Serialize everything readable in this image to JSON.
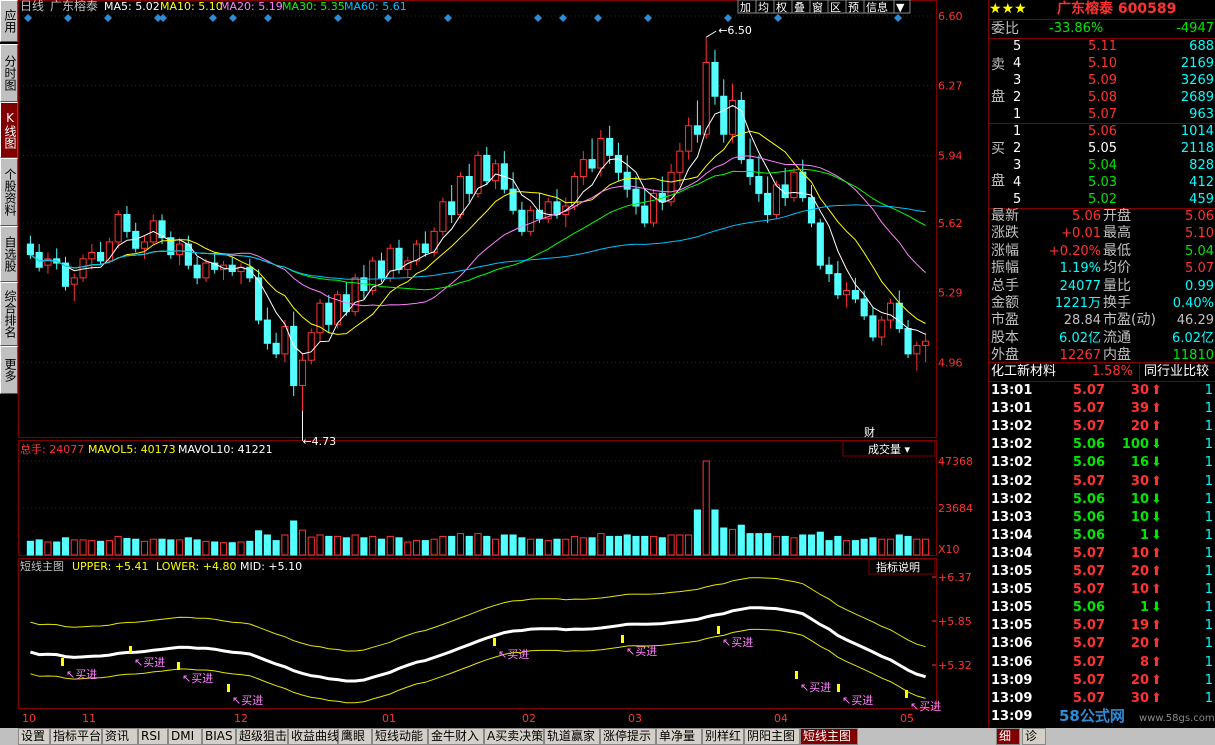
{
  "left_tabs": [
    "应用",
    "分时图",
    "K线图",
    "个股资料",
    "自选股",
    "综合排名",
    "更多"
  ],
  "header": {
    "period": "日线",
    "stock_name": "广东榕泰",
    "ma": [
      {
        "label": "MA5: 5.02",
        "color": "#ffffff"
      },
      {
        "label": "MA10: 5.10",
        "color": "#ffff00"
      },
      {
        "label": "MA20: 5.19",
        "color": "#ff80ff"
      },
      {
        "label": "MA30: 5.35",
        "color": "#00ff00"
      },
      {
        "label": "MA60: 5.61",
        "color": "#00c0ff"
      }
    ],
    "toolbar": [
      "加",
      "均",
      "权",
      "叠",
      "窗",
      "区",
      "预",
      "信息",
      "▼"
    ]
  },
  "price_axis": [
    "6.60",
    "6.27",
    "5.94",
    "5.62",
    "5.29",
    "4.96"
  ],
  "annotations": {
    "high": "6.50",
    "low": "4.73",
    "cai": "财"
  },
  "volume": {
    "label_total": "总手: 24077",
    "label_mavol5": "MAVOL5: 40173",
    "label_mavol10": "MAVOL10: 41221",
    "dropdown": "成交量",
    "axis": [
      "47368",
      "23684"
    ],
    "unit": "X10"
  },
  "indicator": {
    "label_name": "短线主图",
    "label_upper": "UPPER: +5.41",
    "label_lower": "LOWER: +4.80",
    "label_mid": "MID: +5.10",
    "button": "指标说明",
    "axis": [
      "+6.37",
      "+5.85",
      "+5.32"
    ],
    "signal": "买进"
  },
  "date_axis": [
    "10",
    "11",
    "12",
    "01",
    "02",
    "03",
    "04",
    "05"
  ],
  "right": {
    "stars": "★★★",
    "name_code": "广东榕泰 600589",
    "weibi_label": "委比",
    "weibi": "-33.86%",
    "weicha": "-4947",
    "sell_label": [
      "卖",
      "盘"
    ],
    "buy_label": [
      "买",
      "盘"
    ],
    "sells": [
      {
        "lvl": "5",
        "price": "5.11",
        "vol": "688"
      },
      {
        "lvl": "4",
        "price": "5.10",
        "vol": "2169"
      },
      {
        "lvl": "3",
        "price": "5.09",
        "vol": "3269"
      },
      {
        "lvl": "2",
        "price": "5.08",
        "vol": "2689"
      },
      {
        "lvl": "1",
        "price": "5.07",
        "vol": "963"
      }
    ],
    "buys": [
      {
        "lvl": "1",
        "price": "5.06",
        "vol": "1014",
        "pc": "#ff3232"
      },
      {
        "lvl": "2",
        "price": "5.05",
        "vol": "2118",
        "pc": "#ffffff"
      },
      {
        "lvl": "3",
        "price": "5.04",
        "vol": "828",
        "pc": "#00e600"
      },
      {
        "lvl": "4",
        "price": "5.03",
        "vol": "412",
        "pc": "#00e600"
      },
      {
        "lvl": "5",
        "price": "5.02",
        "vol": "459",
        "pc": "#00e600"
      }
    ],
    "stats": [
      {
        "l1": "最新",
        "v1": "5.06",
        "c1": "#ff3232",
        "l2": "开盘",
        "v2": "5.06",
        "c2": "#ff3232"
      },
      {
        "l1": "涨跌",
        "v1": "+0.01",
        "c1": "#ff3232",
        "l2": "最高",
        "v2": "5.10",
        "c2": "#ff3232"
      },
      {
        "l1": "涨幅",
        "v1": "+0.20%",
        "c1": "#ff3232",
        "l2": "最低",
        "v2": "5.04",
        "c2": "#00e600"
      },
      {
        "l1": "振幅",
        "v1": "1.19%",
        "c1": "#00ffff",
        "l2": "均价",
        "v2": "5.07",
        "c2": "#ff3232"
      },
      {
        "l1": "总手",
        "v1": "24077",
        "c1": "#00ffff",
        "l2": "量比",
        "v2": "0.99",
        "c2": "#00ffff"
      },
      {
        "l1": "金额",
        "v1": "1221万",
        "c1": "#00ffff",
        "l2": "换手",
        "v2": "0.40%",
        "c2": "#00ffff"
      },
      {
        "l1": "市盈",
        "v1": "28.84",
        "c1": "#c0c0c0",
        "l2": "市盈(动)",
        "v2": "46.29",
        "c2": "#c0c0c0"
      },
      {
        "l1": "股本",
        "v1": "6.02亿",
        "c1": "#00ffff",
        "l2": "流通",
        "v2": "6.02亿",
        "c2": "#00ffff"
      },
      {
        "l1": "外盘",
        "v1": "12267",
        "c1": "#ff3232",
        "l2": "内盘",
        "v2": "11810",
        "c2": "#00e600"
      }
    ],
    "sector": "化工新材料",
    "sector_pct": "1.58%",
    "sector_btn": "同行业比较",
    "ticks": [
      {
        "t": "13:01",
        "p": "5.07",
        "v": "30",
        "d": "up",
        "n": "1"
      },
      {
        "t": "13:01",
        "p": "5.07",
        "v": "39",
        "d": "up",
        "n": "1"
      },
      {
        "t": "13:02",
        "p": "5.07",
        "v": "20",
        "d": "up",
        "n": "1"
      },
      {
        "t": "13:02",
        "p": "5.06",
        "v": "100",
        "d": "down",
        "n": "1"
      },
      {
        "t": "13:02",
        "p": "5.06",
        "v": "16",
        "d": "down",
        "n": "1"
      },
      {
        "t": "13:02",
        "p": "5.07",
        "v": "30",
        "d": "up",
        "n": "1"
      },
      {
        "t": "13:02",
        "p": "5.06",
        "v": "10",
        "d": "down",
        "n": "1"
      },
      {
        "t": "13:03",
        "p": "5.06",
        "v": "10",
        "d": "down",
        "n": "1"
      },
      {
        "t": "13:04",
        "p": "5.06",
        "v": "1",
        "d": "down",
        "n": "1"
      },
      {
        "t": "13:04",
        "p": "5.07",
        "v": "10",
        "d": "up",
        "n": "1"
      },
      {
        "t": "13:05",
        "p": "5.07",
        "v": "20",
        "d": "up",
        "n": "1"
      },
      {
        "t": "13:05",
        "p": "5.07",
        "v": "10",
        "d": "up",
        "n": "1"
      },
      {
        "t": "13:05",
        "p": "5.06",
        "v": "1",
        "d": "down",
        "n": "1"
      },
      {
        "t": "13:05",
        "p": "5.07",
        "v": "19",
        "d": "up",
        "n": "1"
      },
      {
        "t": "13:06",
        "p": "5.07",
        "v": "20",
        "d": "up",
        "n": "1"
      },
      {
        "t": "13:06",
        "p": "5.07",
        "v": "8",
        "d": "up",
        "n": "1"
      },
      {
        "t": "13:09",
        "p": "5.07",
        "v": "20",
        "d": "up",
        "n": "1"
      },
      {
        "t": "13:09",
        "p": "5.07",
        "v": "30",
        "d": "up",
        "n": "1"
      },
      {
        "t": "13:09",
        "p": "",
        "v": "",
        "d": "",
        "n": ""
      }
    ],
    "tabs": [
      "细",
      "诊"
    ]
  },
  "bottom_tabs": [
    "设置",
    "指标平台",
    "资讯",
    "RSI",
    "DMI",
    "BIAS",
    "超级狙击",
    "收益曲线",
    "鹰眼",
    "短线动能",
    "金牛财入",
    "A买卖决策",
    "轨道赢家",
    "涨停提示",
    "单净量",
    "别样红",
    "阴阳主图",
    "短线主图"
  ],
  "watermark": "58公式网",
  "watermark_url": "www.58gs.com",
  "colors": {
    "up": "#ff3232",
    "down": "#54ffff",
    "frame": "#800000"
  },
  "chart_data": {
    "type": "candlestick",
    "ylim": [
      4.63,
      6.6
    ],
    "candles": [
      [
        5.52,
        5.56,
        5.45,
        5.47
      ],
      [
        5.48,
        5.52,
        5.39,
        5.41
      ],
      [
        5.42,
        5.48,
        5.38,
        5.45
      ],
      [
        5.45,
        5.5,
        5.4,
        5.43
      ],
      [
        5.43,
        5.46,
        5.3,
        5.32
      ],
      [
        5.33,
        5.38,
        5.25,
        5.36
      ],
      [
        5.36,
        5.47,
        5.34,
        5.45
      ],
      [
        5.45,
        5.52,
        5.4,
        5.48
      ],
      [
        5.48,
        5.53,
        5.42,
        5.44
      ],
      [
        5.44,
        5.55,
        5.43,
        5.53
      ],
      [
        5.53,
        5.68,
        5.5,
        5.66
      ],
      [
        5.66,
        5.7,
        5.55,
        5.58
      ],
      [
        5.58,
        5.62,
        5.48,
        5.5
      ],
      [
        5.5,
        5.56,
        5.45,
        5.53
      ],
      [
        5.53,
        5.66,
        5.52,
        5.63
      ],
      [
        5.63,
        5.66,
        5.52,
        5.55
      ],
      [
        5.55,
        5.58,
        5.45,
        5.47
      ],
      [
        5.47,
        5.55,
        5.42,
        5.52
      ],
      [
        5.52,
        5.56,
        5.4,
        5.42
      ],
      [
        5.42,
        5.46,
        5.33,
        5.36
      ],
      [
        5.36,
        5.45,
        5.34,
        5.43
      ],
      [
        5.43,
        5.48,
        5.38,
        5.4
      ],
      [
        5.4,
        5.44,
        5.35,
        5.42
      ],
      [
        5.42,
        5.46,
        5.37,
        5.39
      ],
      [
        5.39,
        5.43,
        5.33,
        5.41
      ],
      [
        5.41,
        5.45,
        5.34,
        5.36
      ],
      [
        5.36,
        5.4,
        5.14,
        5.16
      ],
      [
        5.16,
        5.22,
        5.02,
        5.05
      ],
      [
        5.05,
        5.1,
        4.98,
        5.0
      ],
      [
        5.0,
        5.16,
        4.96,
        5.13
      ],
      [
        5.13,
        5.2,
        4.8,
        4.85
      ],
      [
        4.85,
        5.0,
        4.73,
        4.97
      ],
      [
        4.97,
        5.12,
        4.95,
        5.1
      ],
      [
        5.1,
        5.26,
        5.06,
        5.24
      ],
      [
        5.24,
        5.28,
        5.1,
        5.14
      ],
      [
        5.14,
        5.3,
        5.12,
        5.28
      ],
      [
        5.28,
        5.34,
        5.18,
        5.2
      ],
      [
        5.2,
        5.38,
        5.18,
        5.36
      ],
      [
        5.36,
        5.42,
        5.26,
        5.3
      ],
      [
        5.3,
        5.46,
        5.28,
        5.44
      ],
      [
        5.44,
        5.48,
        5.34,
        5.36
      ],
      [
        5.36,
        5.52,
        5.34,
        5.5
      ],
      [
        5.5,
        5.54,
        5.38,
        5.4
      ],
      [
        5.4,
        5.46,
        5.36,
        5.44
      ],
      [
        5.44,
        5.54,
        5.42,
        5.52
      ],
      [
        5.52,
        5.58,
        5.46,
        5.48
      ],
      [
        5.48,
        5.6,
        5.46,
        5.58
      ],
      [
        5.58,
        5.74,
        5.56,
        5.72
      ],
      [
        5.72,
        5.8,
        5.62,
        5.66
      ],
      [
        5.66,
        5.86,
        5.64,
        5.84
      ],
      [
        5.84,
        5.9,
        5.72,
        5.76
      ],
      [
        5.76,
        5.96,
        5.74,
        5.94
      ],
      [
        5.94,
        5.98,
        5.8,
        5.82
      ],
      [
        5.82,
        5.92,
        5.78,
        5.9
      ],
      [
        5.9,
        5.96,
        5.76,
        5.78
      ],
      [
        5.78,
        5.86,
        5.66,
        5.68
      ],
      [
        5.68,
        5.72,
        5.56,
        5.58
      ],
      [
        5.58,
        5.7,
        5.56,
        5.68
      ],
      [
        5.68,
        5.76,
        5.62,
        5.64
      ],
      [
        5.64,
        5.74,
        5.62,
        5.72
      ],
      [
        5.72,
        5.78,
        5.64,
        5.66
      ],
      [
        5.66,
        5.74,
        5.6,
        5.7
      ],
      [
        5.7,
        5.86,
        5.68,
        5.84
      ],
      [
        5.84,
        5.96,
        5.8,
        5.92
      ],
      [
        5.92,
        6.02,
        5.86,
        5.88
      ],
      [
        5.88,
        6.06,
        5.84,
        6.02
      ],
      [
        6.02,
        6.08,
        5.9,
        5.94
      ],
      [
        5.94,
        6.0,
        5.82,
        5.86
      ],
      [
        5.86,
        5.94,
        5.74,
        5.78
      ],
      [
        5.78,
        5.84,
        5.66,
        5.7
      ],
      [
        5.7,
        5.78,
        5.6,
        5.62
      ],
      [
        5.62,
        5.78,
        5.6,
        5.76
      ],
      [
        5.76,
        5.84,
        5.68,
        5.72
      ],
      [
        5.72,
        5.9,
        5.7,
        5.86
      ],
      [
        5.86,
        6.0,
        5.8,
        5.96
      ],
      [
        5.96,
        6.12,
        5.92,
        6.08
      ],
      [
        6.08,
        6.2,
        6.0,
        6.04
      ],
      [
        6.04,
        6.5,
        6.02,
        6.38
      ],
      [
        6.38,
        6.44,
        6.18,
        6.22
      ],
      [
        6.22,
        6.3,
        6.0,
        6.04
      ],
      [
        6.04,
        6.28,
        6.0,
        6.2
      ],
      [
        6.2,
        6.24,
        5.9,
        5.92
      ],
      [
        5.92,
        6.02,
        5.8,
        5.84
      ],
      [
        5.84,
        5.94,
        5.72,
        5.76
      ],
      [
        5.76,
        5.84,
        5.62,
        5.66
      ],
      [
        5.66,
        5.82,
        5.64,
        5.8
      ],
      [
        5.8,
        5.88,
        5.7,
        5.74
      ],
      [
        5.74,
        5.88,
        5.72,
        5.86
      ],
      [
        5.86,
        5.92,
        5.72,
        5.74
      ],
      [
        5.74,
        5.8,
        5.6,
        5.62
      ],
      [
        5.62,
        5.64,
        5.4,
        5.42
      ],
      [
        5.42,
        5.46,
        5.34,
        5.38
      ],
      [
        5.38,
        5.44,
        5.26,
        5.28
      ],
      [
        5.28,
        5.34,
        5.22,
        5.3
      ],
      [
        5.3,
        5.36,
        5.24,
        5.26
      ],
      [
        5.26,
        5.3,
        5.16,
        5.18
      ],
      [
        5.18,
        5.22,
        5.06,
        5.08
      ],
      [
        5.08,
        5.18,
        5.04,
        5.16
      ],
      [
        5.16,
        5.26,
        5.12,
        5.24
      ],
      [
        5.24,
        5.3,
        5.1,
        5.12
      ],
      [
        5.12,
        5.16,
        4.98,
        5.0
      ],
      [
        5.0,
        5.06,
        4.92,
        5.04
      ],
      [
        5.04,
        5.1,
        4.96,
        5.06
      ]
    ]
  }
}
